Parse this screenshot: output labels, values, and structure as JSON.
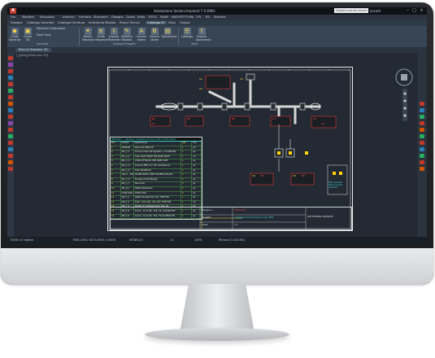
{
  "app": {
    "title": "Valutazione Sezioni-Impianti 7.0.DWG",
    "search_placeholder": "Digitare parola chiave o frase",
    "user": "accedi",
    "brand_color": "#c0392b"
  },
  "menu": [
    "File",
    "Modifica",
    "Visualizza",
    "Inserisci",
    "Formato",
    "Strumenti",
    "Disegna",
    "Quota",
    "Edita",
    "RTOZ",
    "SWAP",
    "ARCHITETTURA",
    "CPL",
    "RZ",
    "Sistema"
  ],
  "tabs": {
    "items": [
      "Disegno",
      "Catalogo Generale",
      "Catalogo Forniture",
      "Interfaccia Modulo",
      "Ritrovi Tecnici",
      "Catalogo EC",
      "Vista",
      "Output"
    ],
    "active_index": 5
  },
  "ribbon": {
    "buttons": [
      "Guida Generale",
      "Guida 3D",
      "Macchine Costruzione",
      "Vista Tiene",
      "Mostra Posizione",
      "Guida Sequenze",
      "Importa Parametri",
      "Modifica Modello",
      "Genera Nome",
      "Genera Nome",
      "Documenta",
      "Catalogo",
      "Esporta Documento"
    ],
    "groups": [
      "Generale",
      "Gestione Progetti",
      "Varie"
    ]
  },
  "doc_tab": "Blocchi Stazione 2D",
  "canvas_label": "[-][Alto][Wireframe 2D]",
  "drawing": {
    "labels": [
      "A1",
      "A2",
      "A3",
      "B1",
      "B2",
      "B3",
      "C1",
      "C2",
      "C3",
      "D1",
      "D2",
      "E1",
      "E2",
      "F1"
    ],
    "note": "Tutti i pannelli devono essere verificati"
  },
  "material_table": {
    "title": "IMPIANTO - Catalogo rivestimento tubi  Ortho HT30 2015",
    "headers": [
      "Pos",
      "Codice",
      "Descrizione",
      "Qta",
      "Um"
    ],
    "rows": [
      [
        "1",
        "5000AB",
        "Raccordo BOX-CP",
        "1",
        "pz"
      ],
      [
        "2",
        "M1_C_1",
        "Curva ricerca all'ingresso + modificata",
        "1",
        "pz"
      ],
      [
        "3",
        "M1_C_2",
        "Tubo GUST WATP DN 65/90 PN25",
        "1",
        "ml"
      ],
      [
        "4",
        "M1_C_3",
        "CODA ATTACCO VEP DN50 GE8",
        "1",
        "pz"
      ],
      [
        "5",
        "M1_C_4",
        "Cuscino PEO con T.P. ventilazione",
        "1",
        "pz"
      ],
      [
        "6",
        "M1_C_5",
        "Tubo 80x60mm",
        "1",
        "pz"
      ],
      [
        "7",
        "Tipo 1 - EN-50-2",
        "SHORT POST CONT DOUBLE PILLAR",
        "3",
        "pz"
      ],
      [
        "8",
        "M1_C_6",
        "Flangia Controflangia",
        "2",
        "pz"
      ],
      [
        "9",
        "M1_C_7",
        "Raccordo",
        "3",
        "pz"
      ],
      [
        "10",
        "M1_D_1",
        "Staffa Tubazione",
        "4",
        "pz"
      ],
      [
        "11",
        "5100-ARO-2",
        "STOP ATTS",
        "2",
        "pz"
      ],
      [
        "12",
        "M4_F_1",
        "Staffa Zincata Dia. 60 / STET PN",
        "1",
        "pz"
      ],
      [
        "13",
        "M4_F_2",
        "Tubo - D:no.40 - Dia. 60 / STET PN",
        "1",
        "ml"
      ],
      [
        "14",
        "M4_F_3",
        "Piastra di Collegamento Dia. 40",
        "1",
        "pz"
      ],
      [
        "15",
        "M4_F_4",
        "Curva - D:no.40 - Dia. 70 / ALCOR 2HT",
        "1",
        "pz"
      ],
      [
        "16",
        "M4_F_5",
        "Curva - D:no.40 - Dia. 70 da DN50 PN",
        "1",
        "pz"
      ]
    ]
  },
  "title_block": {
    "drawing_no": "3190-ST-G",
    "subject": "Collegamento tubazione linea PN5",
    "company": "PIATTAFORMA RICERCHE",
    "scale": "1:1",
    "labels": [
      "Disegno n.",
      "Data",
      "Scala",
      "Revisione",
      "Oggetto"
    ]
  },
  "status": {
    "items": [
      "7564.1934, 6215.0000, 0.0000",
      "MODELLO",
      "1:1",
      "100%",
      "Ritrovo 51-SCCM11"
    ],
    "left": "DVX8 v0 Inglese"
  }
}
